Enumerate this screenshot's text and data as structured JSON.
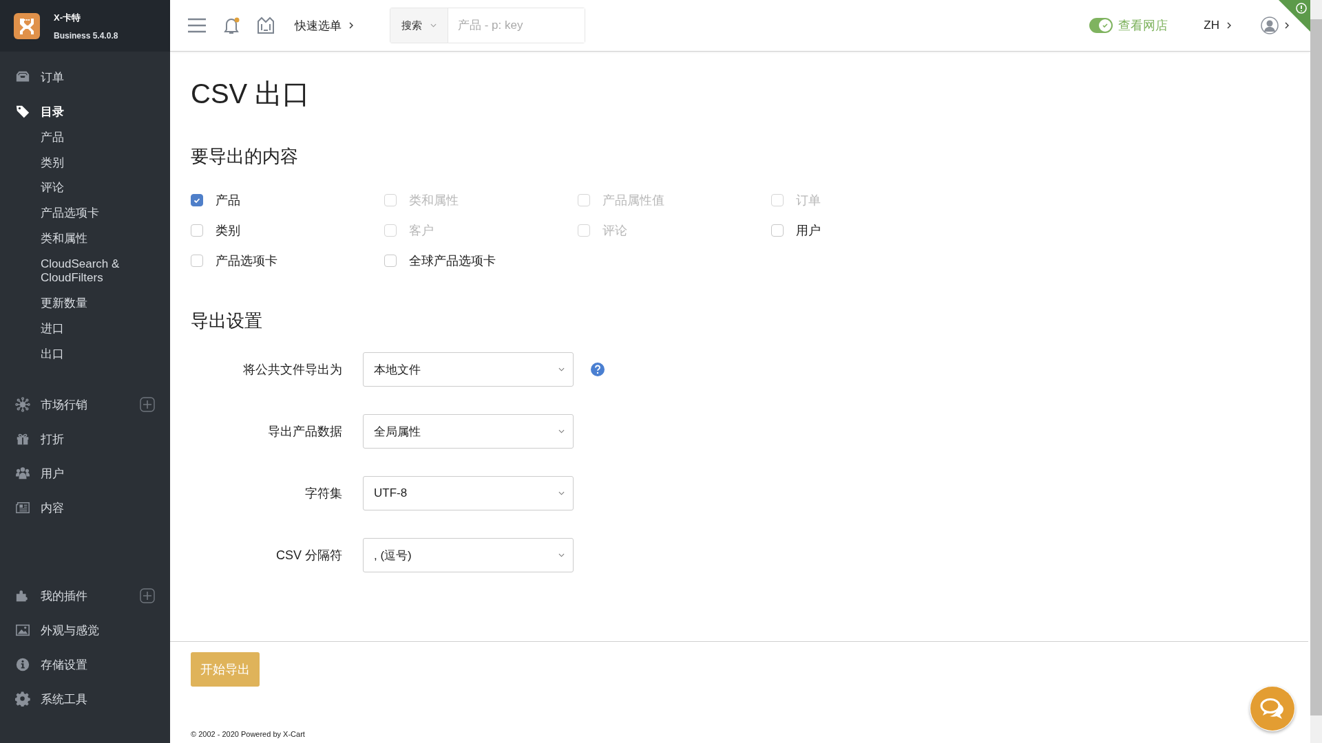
{
  "brand": {
    "name": "X-卡特",
    "version": "Business 5.4.0.8"
  },
  "topbar": {
    "notifications": {
      "unread": true
    },
    "quick_menu": "快速选单",
    "search": {
      "scope": "搜索",
      "placeholder": "产品 - p: key"
    },
    "storefront": {
      "label": "查看网店",
      "on": true
    },
    "language": "ZH"
  },
  "sidebar": {
    "groups": [
      {
        "items": [
          {
            "label": "订单",
            "selected": false,
            "add_button": false
          },
          {
            "label": "目录",
            "selected": true,
            "add_button": false,
            "children": [
              {
                "label": "产品"
              },
              {
                "label": "类别"
              },
              {
                "label": "评论"
              },
              {
                "label": "产品选项卡"
              },
              {
                "label": "类和属性"
              },
              {
                "label": "CloudSearch & CloudFilters"
              },
              {
                "label": "更新数量"
              },
              {
                "label": "进口"
              },
              {
                "label": "出口"
              }
            ]
          },
          {
            "label": "市场行销",
            "selected": false,
            "add_button": true
          },
          {
            "label": "打折",
            "selected": false,
            "add_button": false
          },
          {
            "label": "用户",
            "selected": false,
            "add_button": false
          },
          {
            "label": "内容",
            "selected": false,
            "add_button": false
          }
        ]
      },
      {
        "items": [
          {
            "label": "我的插件",
            "selected": false,
            "add_button": true
          },
          {
            "label": "外观与感觉",
            "selected": false,
            "add_button": false
          },
          {
            "label": "存储设置",
            "selected": false,
            "add_button": false
          },
          {
            "label": "系统工具",
            "selected": false,
            "add_button": false
          }
        ]
      }
    ]
  },
  "page": {
    "title": "CSV 出口",
    "content_section": {
      "heading": "要导出的内容",
      "options": [
        {
          "label": "产品",
          "checked": true,
          "disabled": false
        },
        {
          "label": "类和属性",
          "checked": false,
          "disabled": true
        },
        {
          "label": "产品属性值",
          "checked": false,
          "disabled": true
        },
        {
          "label": "订单",
          "checked": false,
          "disabled": true
        },
        {
          "label": "类别",
          "checked": false,
          "disabled": false
        },
        {
          "label": "客户",
          "checked": false,
          "disabled": true
        },
        {
          "label": "评论",
          "checked": false,
          "disabled": true
        },
        {
          "label": "用户",
          "checked": false,
          "disabled": false
        },
        {
          "label": "产品选项卡",
          "checked": false,
          "disabled": false
        },
        {
          "label": "全球产品选项卡",
          "checked": false,
          "disabled": false
        }
      ]
    },
    "settings_section": {
      "heading": "导出设置",
      "fields": [
        {
          "label": "将公共文件导出为",
          "value": "本地文件",
          "help": true
        },
        {
          "label": "导出产品数据",
          "value": "全局属性"
        },
        {
          "label": "字符集",
          "value": "UTF-8"
        },
        {
          "label": "CSV 分隔符",
          "value": ", (逗号)"
        }
      ]
    },
    "submit_button": "开始导出"
  },
  "footer": "© 2002 - 2020 Powered by X-Cart"
}
